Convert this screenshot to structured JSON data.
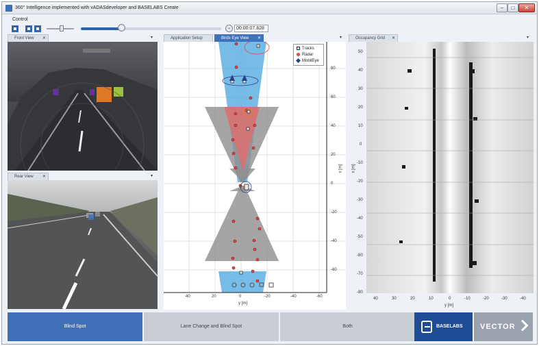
{
  "window": {
    "title": "360° Intelligence implemented with vADASdeveloper and BASELABS Create",
    "min_glyph": "–",
    "max_glyph": "□",
    "close_glyph": "✕"
  },
  "control": {
    "label": "Control",
    "time": "00:00:07.828",
    "progress_fraction": 0.3,
    "time_button_glyph": "⌄"
  },
  "panes": {
    "front_view": {
      "tab": "Front View",
      "close": "✕",
      "menu": "▾"
    },
    "rear_view": {
      "tab": "Rear View",
      "close": "✕",
      "menu": "▾"
    },
    "tabs_middle": {
      "application_setup": "Application Setup",
      "birds_eye_view": "Birds Eye View",
      "close": "✕",
      "menu": "▾"
    },
    "occupancy": {
      "tab": "Occupancy Grid",
      "close": "✕",
      "menu": "▾"
    }
  },
  "birds_eye": {
    "legend": [
      "Tracks",
      "Radar",
      "MobilEye"
    ],
    "x_axis_label": "x [m]",
    "y_axis_label": "y [m]",
    "x_ticks": [
      "80",
      "60",
      "40",
      "20",
      "0",
      "-20",
      "-40",
      "-60"
    ],
    "y_ticks": [
      "40",
      "20",
      "0",
      "-20",
      "-40",
      "-60"
    ]
  },
  "occupancy_grid": {
    "x_axis_label": "x [m]",
    "y_axis_label": "y [m]",
    "x_ticks": [
      "50",
      "40",
      "30",
      "20",
      "10",
      "0",
      "-10",
      "-20",
      "-30",
      "-40",
      "-50",
      "-60",
      "-70",
      "-80"
    ],
    "y_ticks": [
      "40",
      "30",
      "20",
      "10",
      "0",
      "-10",
      "-20",
      "-30",
      "-40"
    ]
  },
  "modes": {
    "blind_spot": "Blind Spot",
    "lane_change": "Lane Change and Blind Spot",
    "both": "Both"
  },
  "logos": {
    "baselabs": "BASELABS",
    "vector": "VECTOR"
  },
  "colors": {
    "accent": "#3f6fb6",
    "radar": "#e0474c",
    "coverage_blue": "#4aa5dd",
    "coverage_grey": "#8e8e8e"
  }
}
